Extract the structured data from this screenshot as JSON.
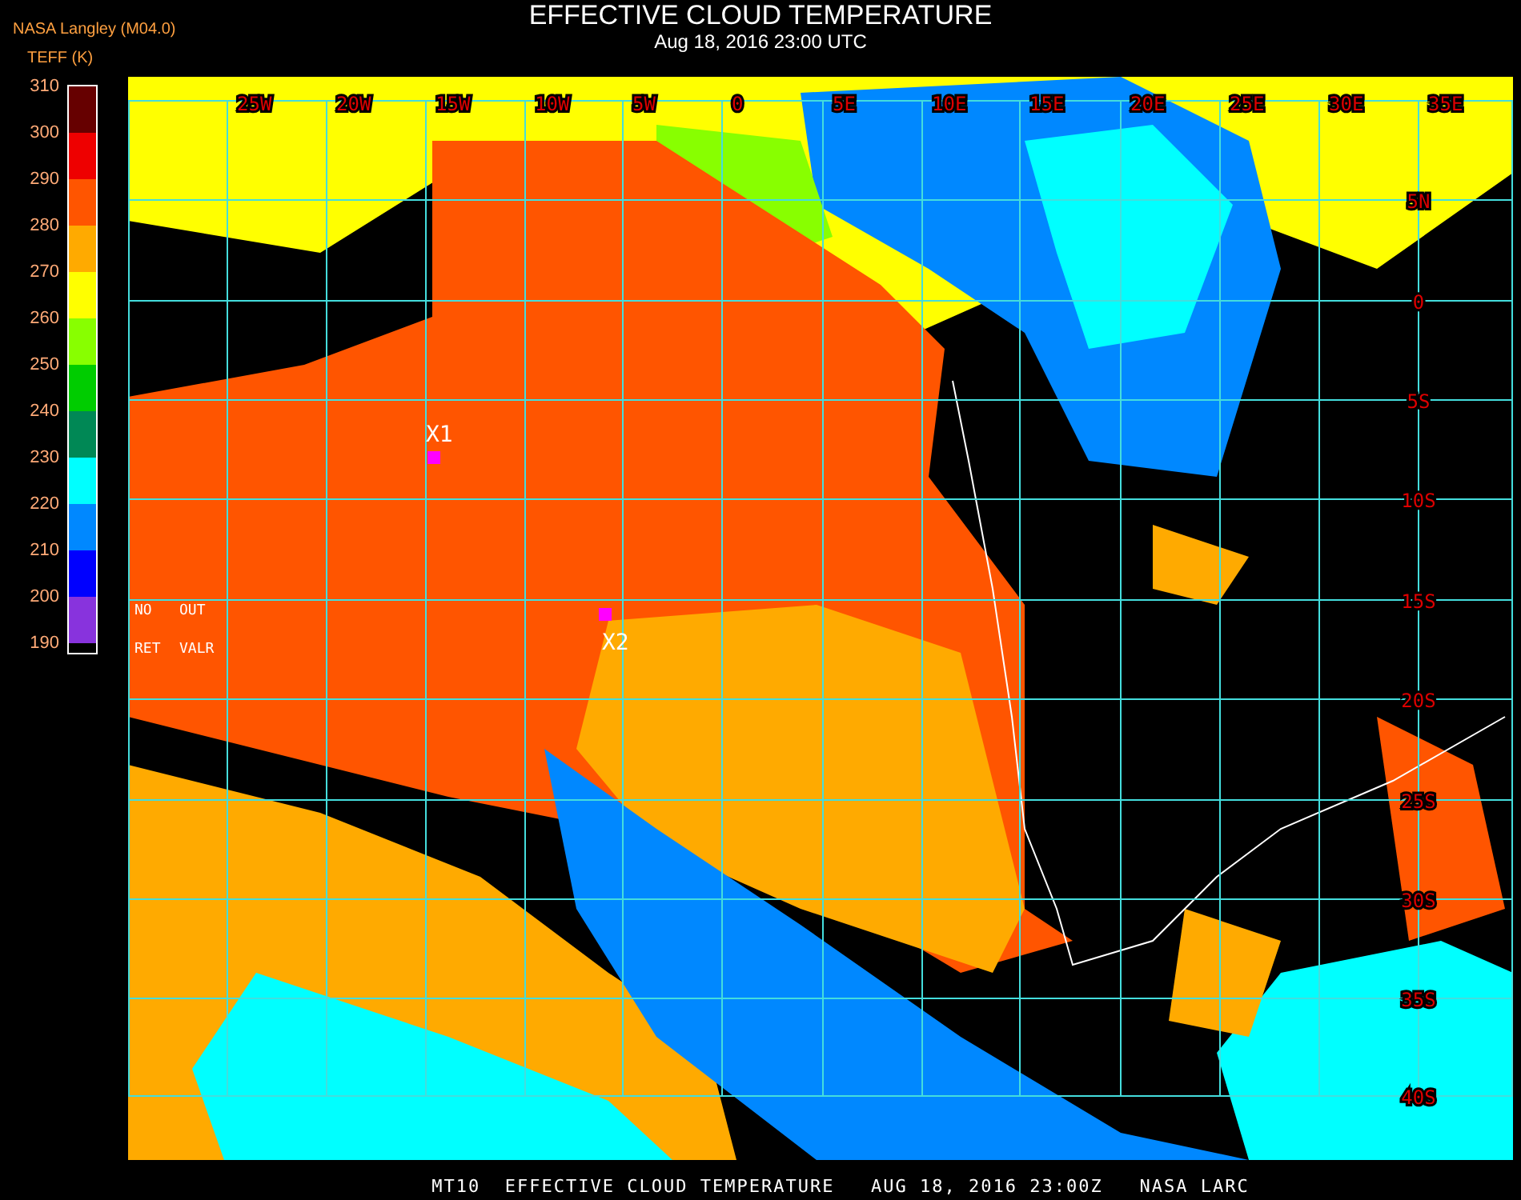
{
  "title": "EFFECTIVE CLOUD TEMPERATURE",
  "subtitle": "Aug 18, 2016 23:00 UTC",
  "source": "NASA Langley (M04.0)",
  "legend": {
    "title": "TEFF (K)",
    "entries": [
      {
        "label": "310",
        "color": "#660000"
      },
      {
        "label": "300",
        "color": "#ee0000"
      },
      {
        "label": "290",
        "color": "#ff5500"
      },
      {
        "label": "280",
        "color": "#ffaa00"
      },
      {
        "label": "270",
        "color": "#ffff00"
      },
      {
        "label": "260",
        "color": "#88ff00"
      },
      {
        "label": "250",
        "color": "#00cc00"
      },
      {
        "label": "240",
        "color": "#008855"
      },
      {
        "label": "230",
        "color": "#00ffff"
      },
      {
        "label": "220",
        "color": "#0088ff"
      },
      {
        "label": "210",
        "color": "#0000ff"
      },
      {
        "label": "200",
        "color": "#8833dd"
      }
    ],
    "bottom_label": "190"
  },
  "no_data_labels": [
    [
      "NO",
      "OUT"
    ],
    [
      "RET",
      "VALR"
    ]
  ],
  "map": {
    "longitude_labels": [
      "25W",
      "20W",
      "15W",
      "10W",
      "5W",
      "0",
      "5E",
      "10E",
      "15E",
      "20E",
      "25E",
      "30E",
      "35E"
    ],
    "latitude_labels": [
      "5N",
      "0",
      "5S",
      "10S",
      "15S",
      "20S",
      "25S",
      "30S",
      "35S",
      "40S"
    ],
    "markers": [
      {
        "label": "X1"
      },
      {
        "label": "X2"
      }
    ]
  },
  "footer": "MT10  EFFECTIVE CLOUD TEMPERATURE   AUG 18, 2016 23:00Z   NASA LARC"
}
